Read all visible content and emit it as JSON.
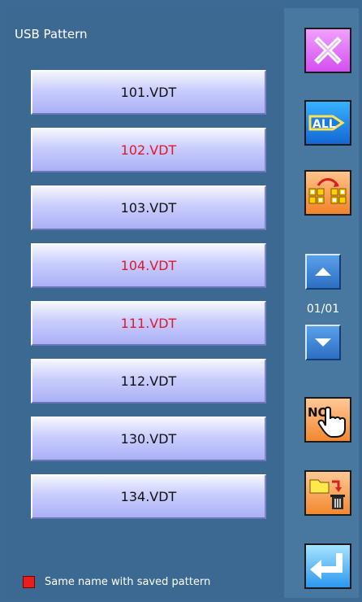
{
  "screen": {
    "title": "USB Pattern"
  },
  "patterns": [
    {
      "name": "101.VDT",
      "same_name": false
    },
    {
      "name": "102.VDT",
      "same_name": true
    },
    {
      "name": "103.VDT",
      "same_name": false
    },
    {
      "name": "104.VDT",
      "same_name": true
    },
    {
      "name": "111.VDT",
      "same_name": true
    },
    {
      "name": "112.VDT",
      "same_name": false
    },
    {
      "name": "130.VDT",
      "same_name": false
    },
    {
      "name": "134.VDT",
      "same_name": false
    }
  ],
  "side_buttons": {
    "close_icon": "close-icon",
    "all_icon": "all-icon",
    "all_label": "ALL",
    "swap_icon": "swap-icon",
    "no_icon": "number-select-icon",
    "no_label": "NO.",
    "move_icon": "folder-delete-icon",
    "enter_icon": "enter-icon"
  },
  "pagination": {
    "text": "01/01",
    "up_icon": "up-arrow-icon",
    "down_icon": "down-arrow-icon"
  },
  "legend": {
    "text": "Same name with saved pattern",
    "color": "#e81d1d"
  },
  "colors": {
    "duplicate_text": "#e0182b",
    "normal_text": "#111111",
    "panel_bg": "#3c6991"
  }
}
